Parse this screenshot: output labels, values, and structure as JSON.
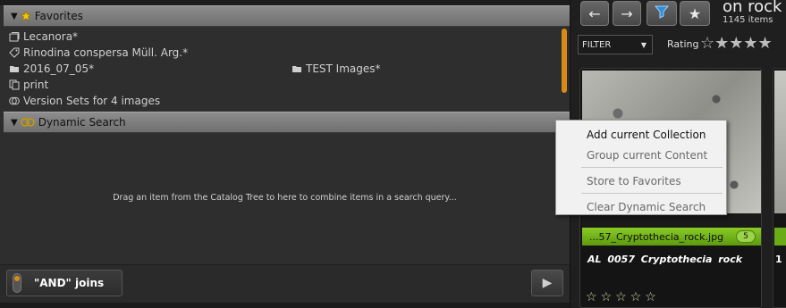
{
  "favorites": {
    "title": "Favorites",
    "items": [
      {
        "label": "Lecanora*",
        "icon": "collection-icon"
      },
      {
        "label": "Rinodina conspersa Müll. Arg.*",
        "icon": "tag-icon"
      },
      {
        "label": "2016_07_05*",
        "icon": "folder-icon"
      },
      {
        "label": "TEST Images*",
        "icon": "folder-icon"
      },
      {
        "label": "print",
        "icon": "copy-icon"
      },
      {
        "label": "Version Sets for 4 images",
        "icon": "version-set-icon"
      }
    ]
  },
  "dynamic_search": {
    "title": "Dynamic Search",
    "hint": "Drag an item from the Catalog Tree to here to combine items in a search query...",
    "and_joins_label": "\"AND\" joins",
    "play_symbol": "▶"
  },
  "context_menu": {
    "items": [
      {
        "label": "Add current Collection",
        "active": true
      },
      {
        "label": "Group current Content",
        "active": false
      },
      {
        "label": "Store to Favorites",
        "active": false
      },
      {
        "label": "Clear Dynamic Search",
        "active": false
      }
    ]
  },
  "toolbar": {
    "back_symbol": "←",
    "forward_symbol": "→",
    "star_symbol": "★",
    "collection_title": "on rock",
    "collection_count": "1145 items"
  },
  "filter": {
    "selected": "FILTER",
    "rating_label": "Rating",
    "rating_stars": "☆★★★★",
    "caret": "▼"
  },
  "thumbnail": {
    "filename": "...57_Cryptothecia_rock.jpg",
    "badge": "5",
    "caption": "AL 0057 Cryptothecia rock",
    "stars": "☆☆☆☆☆"
  },
  "side_thumbnail": {
    "caption": "1"
  },
  "colors": {
    "accent_orange": "#d98b18",
    "label_green": "#6aab18",
    "filter_blue": "#2f8fd8"
  }
}
